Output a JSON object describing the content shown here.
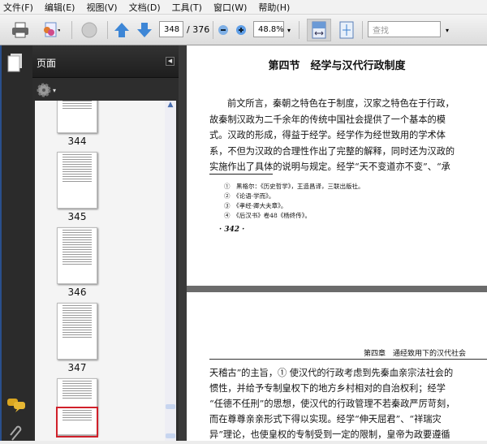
{
  "menu": [
    "文件(F)",
    "编辑(E)",
    "视图(V)",
    "文档(D)",
    "工具(T)",
    "窗口(W)",
    "帮助(H)"
  ],
  "toolbar": {
    "page_current": "348",
    "page_total": "/ 376",
    "zoom": "48.8%",
    "find_placeholder": "查找"
  },
  "panel": {
    "title": "页面"
  },
  "thumbnails": [
    {
      "label": "344"
    },
    {
      "label": "345"
    },
    {
      "label": "346"
    },
    {
      "label": "347"
    }
  ],
  "page1": {
    "title": "第四节　经学与汉代行政制度",
    "body": [
      "前文所言，秦朝之特色在于制度，汉家之特色在于行政，",
      "故秦制汉政为二千余年的传统中国社会提供了一个基本的模",
      "式。汉政的形成，得益于经学。经学作为经世致用的学术体",
      "系，不但为汉政的合理性作出了完整的解释，同时还为汉政的",
      "实施作出了具体的说明与规定。经学“天不变道亦不变”、“承"
    ],
    "footnotes": [
      "①　黑格尔：《历史哲学》，王造昌译，三联出版社。",
      "②　《论语·学而》。",
      "③　《孝经·卿大夫章》。",
      "④　《后汉书》卷48《杨终传》。"
    ],
    "page_number": "· 342 ·"
  },
  "page2": {
    "header": "第四章　通经致用下的汉代社会",
    "body": [
      "天稽古”的主旨，① 使汉代的行政考虑到先秦血亲宗法社会的",
      "惯性，并给予专制皇权下的地方乡村相对的自治权利；经学",
      "“任德不任刑”的思想，使汉代的行政管理不若秦政严厉苛刻，",
      "而在尊尊亲亲形式下得以实现。经学“伸天屈君”、“祥瑞灾",
      "异”理论，也使皇权的专制受到一定的限制，皇帝为政要遵循"
    ]
  }
}
